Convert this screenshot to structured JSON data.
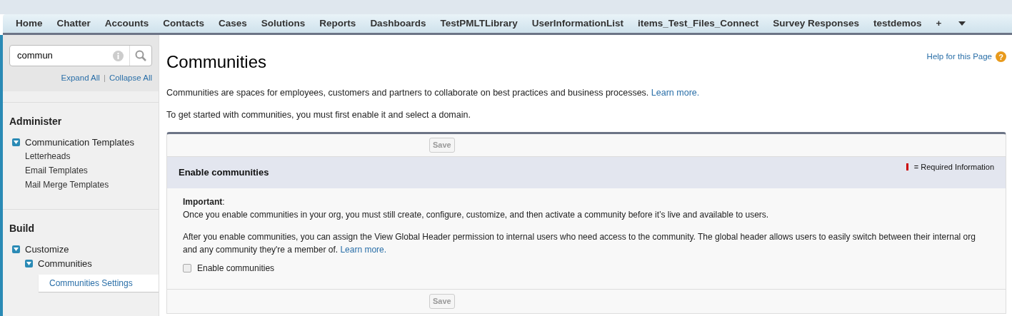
{
  "tabs": [
    {
      "label": "Home",
      "selected": false
    },
    {
      "label": "Chatter",
      "selected": false
    },
    {
      "label": "Accounts",
      "selected": false
    },
    {
      "label": "Contacts",
      "selected": false
    },
    {
      "label": "Cases",
      "selected": false
    },
    {
      "label": "Solutions",
      "selected": false
    },
    {
      "label": "Reports",
      "selected": false
    },
    {
      "label": "Dashboards",
      "selected": false
    },
    {
      "label": "TestPMLTLibrary",
      "selected": false
    },
    {
      "label": "UserInformationList",
      "selected": false
    },
    {
      "label": "items_Test_Files_Connect",
      "selected": false
    },
    {
      "label": "Survey Responses",
      "selected": false
    },
    {
      "label": "testdemos",
      "selected": false
    },
    {
      "label": "+",
      "selected": false
    }
  ],
  "sidebar": {
    "search": {
      "value": "commun"
    },
    "expand_all": "Expand All",
    "collapse_all": "Collapse All",
    "link_separator": "|",
    "sections": [
      {
        "title": "Administer",
        "items": [
          {
            "label": "Communication Templates",
            "expanded": true,
            "selected": false,
            "children": [
              {
                "label": "Letterheads",
                "selected": false
              },
              {
                "label": "Email Templates",
                "selected": false
              },
              {
                "label": "Mail Merge Templates",
                "selected": false
              }
            ]
          }
        ]
      },
      {
        "title": "Build",
        "items": [
          {
            "label": "Customize",
            "expanded": true,
            "selected": false,
            "children": [
              {
                "label": "Communities",
                "expanded": true,
                "selected": false,
                "children": [
                  {
                    "label": "Communities Settings",
                    "selected": true
                  }
                ]
              }
            ]
          }
        ]
      }
    ]
  },
  "page": {
    "title": "Communities",
    "help": "Help for this Page",
    "help_icon": "?",
    "intro": {
      "text": "Communities are spaces for employees, customers and partners to collaborate on best practices and business processes.",
      "link": "Learn more."
    },
    "note": "To get started with communities, you must first enable it and select a domain.",
    "form": {
      "save_top": "Save",
      "save_bottom": "Save",
      "section_title": "Enable communities",
      "required_legend": "= Required Information",
      "important_label": "**Important**:",
      "important_text": "Once you enable communities in your org, you must still create, configure, customize, and then activate a community before it’s live and available to users.",
      "after": {
        "text": "After you enable communities, you can assign the View Global Header permission to internal users who need access to the community. The global header allows users to easily switch between their internal org and any community they're a member of.",
        "link": "Learn more."
      },
      "checkbox": {
        "label": "Enable communities",
        "checked": false
      }
    }
  }
}
